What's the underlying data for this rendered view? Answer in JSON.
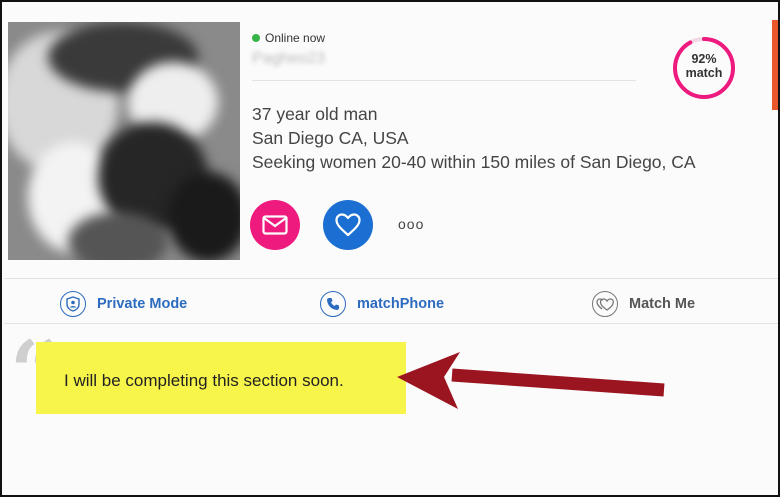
{
  "profile": {
    "online_status": "Online now",
    "username": "Pagheo23",
    "age_gender": "37 year old man",
    "location": "San Diego CA, USA",
    "seeking": "Seeking women 20-40 within 150 miles of San Diego, CA",
    "match_percent": "92%",
    "match_label": "match",
    "match_fraction": 0.92,
    "more_label": "ooo"
  },
  "toolbar": {
    "private_mode": "Private Mode",
    "match_phone": "matchPhone",
    "match_me": "Match Me"
  },
  "about": {
    "text": "I will be completing this section soon."
  },
  "colors": {
    "online": "#36b24a",
    "match_ring": "#ee1a7e",
    "mail_button": "#ee1a7e",
    "heart_button": "#1c6fd2",
    "link_blue": "#2c6bbf",
    "highlight": "#f8f54a",
    "arrow": "#9b1520"
  },
  "icons": {
    "mail": "envelope-icon",
    "heart": "heart-icon",
    "private": "shield-user-icon",
    "phone": "phone-icon",
    "matchme": "double-heart-icon"
  }
}
